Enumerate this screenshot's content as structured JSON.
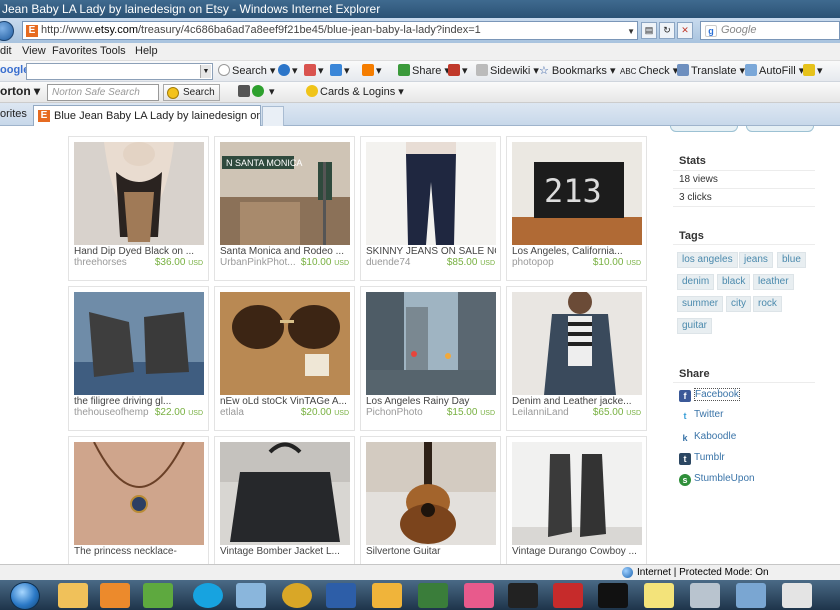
{
  "window": {
    "title": "Jean Baby LA Lady by lainedesign on Etsy - Windows Internet Explorer"
  },
  "address_bar": {
    "url_prefix": "http://www.",
    "url_domain": "etsy.com",
    "url_path": "/treasury/4c686ba6ad7a8eef9f21be45/blue-jean-baby-la-lady?index=1",
    "search_placeholder": "Google"
  },
  "menu": [
    "dit",
    "View",
    "Favorites",
    "Tools",
    "Help"
  ],
  "google_toolbar": {
    "logo": "oogle",
    "search_label": "Search",
    "items": [
      "Share",
      "Sidewiki",
      "Bookmarks",
      "Check",
      "Translate",
      "AutoFill"
    ]
  },
  "norton_toolbar": {
    "logo": "orton",
    "search_placeholder": "Norton Safe Search",
    "search_label": "Search",
    "cards_label": "Cards & Logins"
  },
  "tab_row": {
    "favorites_label": "orites",
    "active_tab": "Blue Jean Baby LA Lady by lainedesign on Etsy"
  },
  "items": [
    {
      "title": "Hand Dip Dyed Black on ...",
      "shop": "threehorses",
      "price": "$36.00",
      "currency": "USD"
    },
    {
      "title": "Santa Monica and Rodeo ...",
      "shop": "UrbanPinkPhot...",
      "price": "$10.00",
      "currency": "USD"
    },
    {
      "title": "SKINNY JEANS ON SALE NO...",
      "shop": "duende74",
      "price": "$85.00",
      "currency": "USD"
    },
    {
      "title": "Los Angeles, California...",
      "shop": "photopop",
      "price": "$10.00",
      "currency": "USD"
    },
    {
      "title": "the filigree driving gl...",
      "shop": "thehouseofhemp",
      "price": "$22.00",
      "currency": "USD"
    },
    {
      "title": "nEw oLd stoCk VinTAGe A...",
      "shop": "etlala",
      "price": "$20.00",
      "currency": "USD"
    },
    {
      "title": "Los Angeles Rainy Day",
      "shop": "PichonPhoto",
      "price": "$15.00",
      "currency": "USD"
    },
    {
      "title": "Denim and Leather jacke...",
      "shop": "LeilanniLand",
      "price": "$65.00",
      "currency": "USD"
    },
    {
      "title": "The princess necklace-",
      "shop": "",
      "price": "",
      "currency": ""
    },
    {
      "title": "Vintage Bomber Jacket L...",
      "shop": "",
      "price": "",
      "currency": ""
    },
    {
      "title": "Silvertone Guitar",
      "shop": "",
      "price": "",
      "currency": ""
    },
    {
      "title": "Vintage Durango Cowboy ...",
      "shop": "",
      "price": "",
      "currency": ""
    }
  ],
  "sidebar": {
    "stats_heading": "Stats",
    "views": "18 views",
    "clicks": "3 clicks",
    "tags_heading": "Tags",
    "tags": [
      "los angeles",
      "jeans",
      "blue",
      "denim",
      "black",
      "leather",
      "summer",
      "city",
      "rock",
      "guitar"
    ],
    "share_heading": "Share",
    "share": [
      "Facebook",
      "Twitter",
      "Kaboodle",
      "Tumblr",
      "StumbleUpon"
    ]
  },
  "status_bar": {
    "zone": "Internet | Protected Mode: On"
  },
  "taskbar": {
    "icons": [
      "ie-icon",
      "folder-icon",
      "media-player-icon",
      "people-icon",
      "skype-icon",
      "itunes-icon",
      "globe-icon",
      "word-icon",
      "app-icon",
      "arc-icon",
      "pinwheel-icon",
      "eye-icon",
      "acrobat-icon",
      "play-icon",
      "sticky-notes-icon",
      "calculator-icon",
      "itunes-icon-2",
      "app-icon-2"
    ]
  }
}
